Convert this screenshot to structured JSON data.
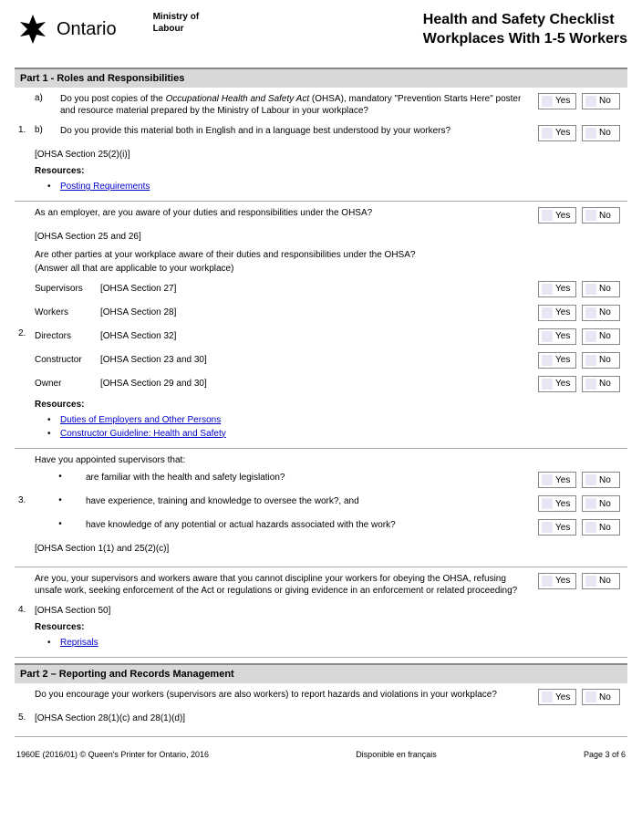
{
  "header": {
    "wordmark": "Ontario",
    "ministry_line1": "Ministry of",
    "ministry_line2": "Labour",
    "title_line1": "Health and Safety Checklist",
    "title_line2": "Workplaces With 1-5 Workers"
  },
  "part1": {
    "heading": "Part 1 - Roles and Responsibilities",
    "q1": {
      "num": "1.",
      "a_letter": "a)",
      "a_text_pre": "Do you post copies of the ",
      "a_text_em": "Occupational Health and Safety Act",
      "a_text_post": " (OHSA), mandatory \"Prevention Starts Here\" poster and resource material prepared by the Ministry of Labour in your workplace?",
      "b_letter": "b)",
      "b_text": "Do you provide this material both in English and in a language best understood by your workers?",
      "ref": "[OHSA Section 25(2)(i)]",
      "resources_label": "Resources:",
      "link1": "Posting Requirements"
    },
    "q2": {
      "num": "2.",
      "intro": "As an employer, are you aware of your duties and responsibilities under the OHSA?",
      "ref1": "[OHSA Section 25 and 26]",
      "other_intro1": "Are other parties at your workplace aware of their duties and responsibilities under the OHSA?",
      "other_intro2": "(Answer all that are applicable to your workplace)",
      "roles": [
        {
          "name": "Supervisors",
          "ref": "[OHSA Section 27]"
        },
        {
          "name": "Workers",
          "ref": "[OHSA Section 28]"
        },
        {
          "name": "Directors",
          "ref": "[OHSA Section 32]"
        },
        {
          "name": "Constructor",
          "ref": "[OHSA Section 23 and 30]"
        },
        {
          "name": "Owner",
          "ref": "[OHSA Section 29 and 30]"
        }
      ],
      "resources_label": "Resources:",
      "link1": "Duties of Employers and Other Persons",
      "link2": "Constructor Guideline: Health and Safety"
    },
    "q3": {
      "num": "3.",
      "intro": "Have you appointed supervisors that:",
      "items": [
        "are familiar with the health and safety legislation?",
        "have experience, training and knowledge to oversee the work?, and",
        "have knowledge of any potential or actual hazards associated with the work?"
      ],
      "ref": "[OHSA Section 1(1) and 25(2)(c)]"
    },
    "q4": {
      "num": "4.",
      "text": "Are you, your supervisors and workers aware that you cannot discipline your workers for obeying the OHSA, refusing unsafe work, seeking enforcement of the Act or regulations or giving evidence in an enforcement or related proceeding?",
      "ref": "[OHSA Section 50]",
      "resources_label": "Resources:",
      "link1": "Reprisals"
    }
  },
  "part2": {
    "heading": "Part 2 – Reporting and Records Management",
    "q5": {
      "num": "5.",
      "text": "Do you encourage your workers (supervisors are also workers) to report hazards and violations in your workplace?",
      "ref": "[OHSA Section 28(1)(c) and 28(1)(d)]"
    }
  },
  "yn": {
    "yes": "Yes",
    "no": "No"
  },
  "footer": {
    "left": "1960E (2016/01)      © Queen's Printer for Ontario, 2016",
    "center": "Disponible en français",
    "right": "Page 3 of 6"
  }
}
